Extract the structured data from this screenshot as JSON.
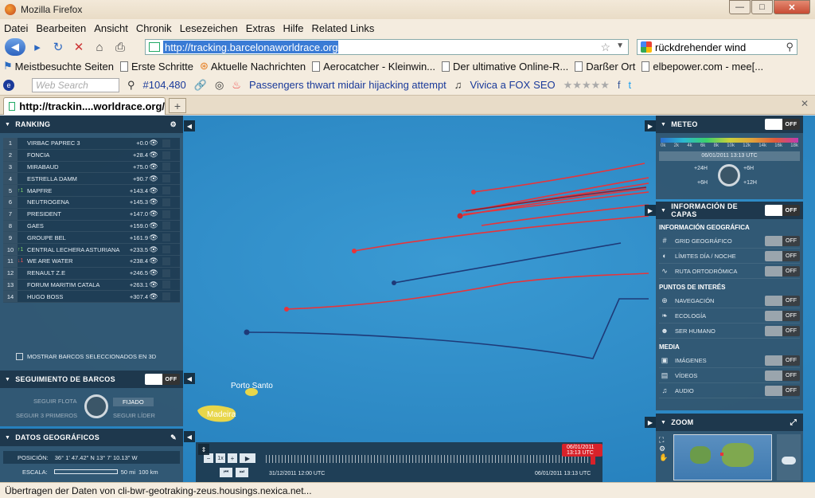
{
  "window": {
    "title": "Mozilla Firefox",
    "btn_min": "—",
    "btn_max": "□",
    "btn_close": "✕"
  },
  "menu": [
    "Datei",
    "Bearbeiten",
    "Ansicht",
    "Chronik",
    "Lesezeichen",
    "Extras",
    "Hilfe",
    "Related Links"
  ],
  "nav": {
    "url": "http://tracking.barcelonaworldrace.org/",
    "search_value": "rückdrehender wind"
  },
  "bookmarks": [
    "Meistbesuchte Seiten",
    "Erste Schritte",
    "Aktuelle Nachrichten",
    "Aerocatcher - Kleinwin...",
    "Der ultimative Online-R...",
    "Darßer Ort",
    "elbepower.com - mee[..."
  ],
  "toolbar2": {
    "search_placeholder": "Web Search",
    "count": "#104,480",
    "headline": "Passengers thwart midair hijacking attempt",
    "vivica": "Vivica a FOX",
    "seo": "SEO"
  },
  "tab": {
    "title": "http://trackin....worldrace.org/",
    "new": "+",
    "close": "✕"
  },
  "ranking": {
    "title": "RANKING",
    "rows": [
      {
        "pos": "1",
        "change": "",
        "name": "VIRBAC PAPREC 3",
        "delta": "+0.0"
      },
      {
        "pos": "2",
        "change": "",
        "name": "FONCIA",
        "delta": "+28.4"
      },
      {
        "pos": "3",
        "change": "",
        "name": "MIRABAUD",
        "delta": "+75.0"
      },
      {
        "pos": "4",
        "change": "",
        "name": "ESTRELLA DAMM",
        "delta": "+90.7"
      },
      {
        "pos": "5",
        "change": "↑1",
        "name": "MAPFRE",
        "delta": "+143.4"
      },
      {
        "pos": "6",
        "change": "",
        "name": "NEUTROGENA",
        "delta": "+145.3"
      },
      {
        "pos": "7",
        "change": "",
        "name": "PRESIDENT",
        "delta": "+147.0"
      },
      {
        "pos": "8",
        "change": "",
        "name": "GAES",
        "delta": "+159.0"
      },
      {
        "pos": "9",
        "change": "",
        "name": "GROUPE BEL",
        "delta": "+161.9"
      },
      {
        "pos": "10",
        "change": "↑1",
        "name": "CENTRAL LECHERA ASTURIANA",
        "delta": "+233.5"
      },
      {
        "pos": "11",
        "change": "↓1",
        "name": "WE ARE WATER",
        "delta": "+238.4"
      },
      {
        "pos": "12",
        "change": "",
        "name": "RENAULT Z.E",
        "delta": "+246.5"
      },
      {
        "pos": "13",
        "change": "",
        "name": "FORUM MARITIM CATALA",
        "delta": "+263.1"
      },
      {
        "pos": "14",
        "change": "",
        "name": "HUGO BOSS",
        "delta": "+307.4"
      }
    ],
    "show3d": "MOSTRAR BARCOS SELECCIONADOS EN 3D"
  },
  "tracking": {
    "title": "SEGUIMIENTO DE BARCOS",
    "toggle": "OFF",
    "opt1": "SEGUIR FLOTA",
    "opt2": "FIJADO",
    "opt3": "SEGUIR 3 PRIMEROS",
    "opt4": "SEGUIR LÍDER"
  },
  "geo": {
    "title": "DATOS GEOGRÁFICOS",
    "pos_label": "POSICIÓN:",
    "pos_value": "36° 1' 47.42\" N  13° 7' 10.13\" W",
    "scale_label": "ESCALA:",
    "scale1": "50 mi",
    "scale2": "100 km"
  },
  "meteo": {
    "title": "METEO",
    "toggle": "OFF",
    "ticks": [
      "0k",
      "2k",
      "4k",
      "6k",
      "8k",
      "10k",
      "12k",
      "14k",
      "16k",
      "18k"
    ],
    "date": "06/01/2011 13:13 UTC",
    "t1": "+24H",
    "t2": "+6H",
    "t3": "+6H",
    "t4": "+12H"
  },
  "layers": {
    "title": "INFORMACIÓN DE CAPAS",
    "toggle": "OFF",
    "sec1": "INFORMACIÓN GEOGRÁFICA",
    "items1": [
      "GRID GEOGRÁFICO",
      "LÍMITES DÍA / NOCHE",
      "RUTA ORTODRÓMICA"
    ],
    "sec2": "PUNTOS DE INTERÉS",
    "items2": [
      "NAVEGACIÓN",
      "ECOLOGÍA",
      "SER HUMANO"
    ],
    "sec3": "MEDIA",
    "items3": [
      "IMÁGENES",
      "VÍDEOS",
      "AUDIO"
    ],
    "off": "OFF"
  },
  "zoom": {
    "title": "ZOOM"
  },
  "map": {
    "label1": "Porto Santo",
    "label2": "Madeira"
  },
  "timeline": {
    "start": "31/12/2011 12:00 UTC",
    "end": "06/01/2011 13:13 UTC",
    "current": "06/01/2011 13:13 UTC"
  },
  "status": "Übertragen der Daten von cli-bwr-geotraking-zeus.housings.nexica.net..."
}
